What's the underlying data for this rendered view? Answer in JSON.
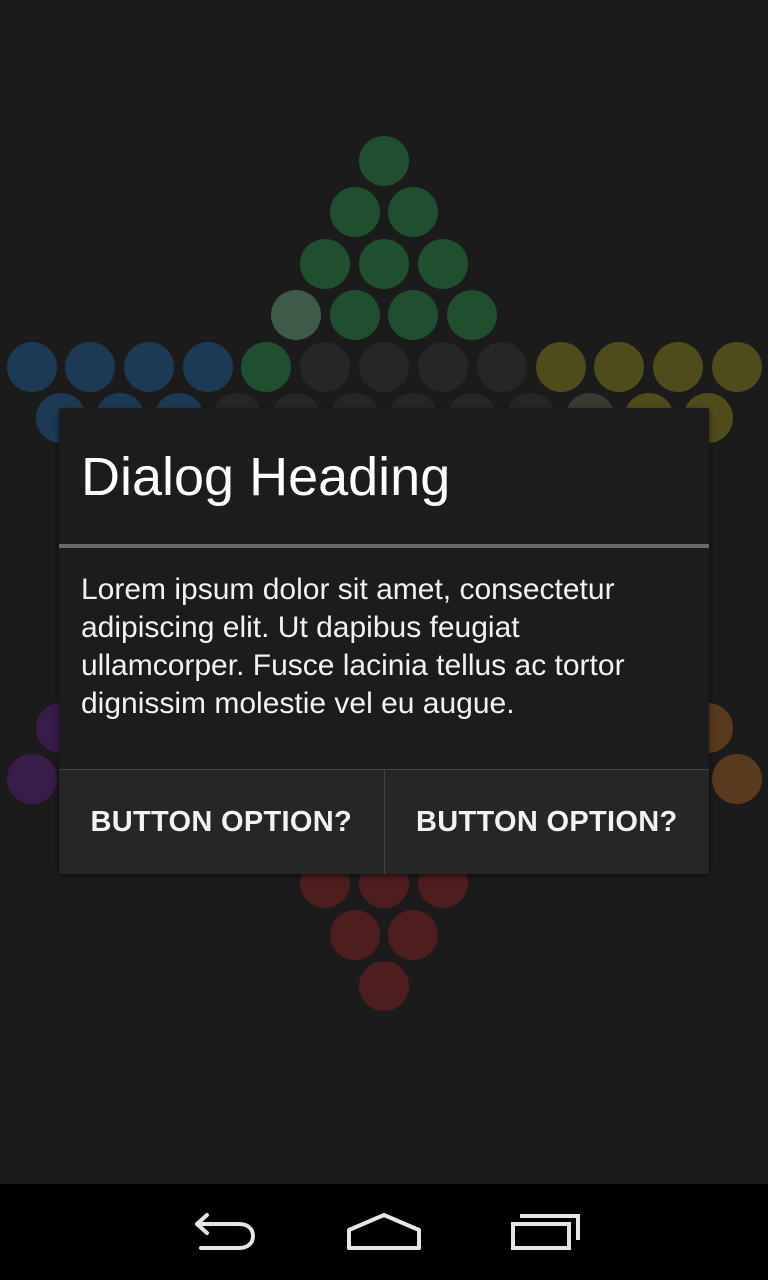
{
  "dialog": {
    "title": "Dialog Heading",
    "message": "Lorem ipsum dolor sit amet, consectetur adipiscing elit. Ut dapibus feugiat ullamcorper. Fusce lacinia tellus ac tortor dignissim molestie vel eu augue.",
    "buttons": [
      {
        "label": "BUTTON OPTION?"
      },
      {
        "label": "BUTTON OPTION?"
      }
    ]
  },
  "navigation": {
    "back_icon": "back-arrow-icon",
    "home_icon": "home-icon",
    "recents_icon": "recent-apps-icon"
  },
  "colors": {
    "background": "#1b1b1b",
    "green": "#1f4f2e",
    "green_highlight": "#3e5a48",
    "blue": "#1d3a55",
    "yellow": "#4f4c1c",
    "empty": "#262626",
    "purple": "#3a1c4a",
    "orange": "#5a3a1e",
    "red": "#4e1e1e",
    "dialog_bg": "#1c1c1c",
    "divider": "#6a6a6a"
  }
}
